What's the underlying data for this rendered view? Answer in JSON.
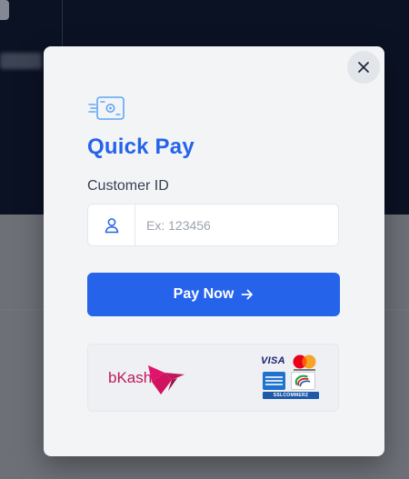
{
  "modal": {
    "title": "Quick Pay",
    "close_icon": "close-icon",
    "header_icon": "fast-payment-icon"
  },
  "customer": {
    "label": "Customer ID",
    "placeholder": "Ex: 123456",
    "value": "",
    "icon": "user-icon"
  },
  "pay_button": {
    "label": "Pay Now",
    "icon": "arrow-right-icon"
  },
  "payment_methods": {
    "bkash": "bKash",
    "cards": {
      "visa": "VISA",
      "gateway": "SSLCOMMERZ"
    }
  },
  "colors": {
    "accent": "#2563eb",
    "modal_bg": "#f3f4f6",
    "bkash": "#c2185b"
  }
}
